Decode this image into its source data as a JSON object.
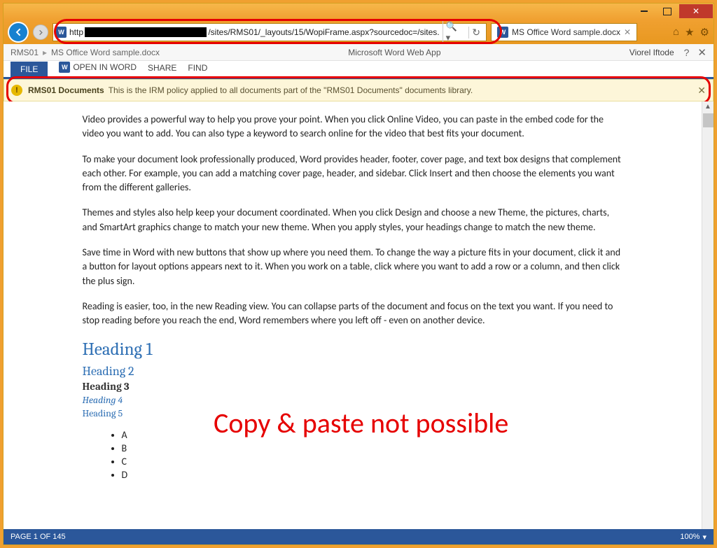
{
  "browser": {
    "url_prefix": "http",
    "url_suffix": "/sites/RMS01/_layouts/15/WopiFrame.aspx?sourcedoc=/sites.",
    "tab_title": "MS Office Word sample.docx"
  },
  "breadcrumb": {
    "site": "RMS01",
    "doc": "MS Office Word sample.docx",
    "app_name": "Microsoft Word Web App",
    "user": "Viorel Iftode"
  },
  "ribbon": {
    "file": "FILE",
    "open": "OPEN IN WORD",
    "share": "SHARE",
    "find": "FIND"
  },
  "notification": {
    "title": "RMS01 Documents",
    "text": "This is the IRM policy applied to all documents part of the \"RMS01 Documents\" documents library."
  },
  "document": {
    "p1": "Video provides a powerful way to help you prove your point. When you click Online Video, you can paste in the embed code for the video you want to add. You can also type a keyword to search online for the video that best fits your document.",
    "p2": "To make your document look professionally produced, Word provides header, footer, cover page, and text box designs that complement each other. For example, you can add a matching cover page, header, and sidebar. Click Insert and then choose the elements you want from the different galleries.",
    "p3": "Themes and styles also help keep your document coordinated. When you click Design and choose a new Theme, the pictures, charts, and SmartArt graphics change to match your new theme. When you apply styles, your headings change to match the new theme.",
    "p4": "Save time in Word with new buttons that show up where you need them. To change the way a picture fits in your document, click it and a button for layout options appears next to it. When you work on a table, click where you want to add a row or a column, and then click the plus sign.",
    "p5": "Reading is easier, too, in the new Reading view. You can collapse parts of the document and focus on the text you want. If you need to stop reading before you reach the end, Word remembers where you left off - even on another device.",
    "h1": "Heading 1",
    "h2": "Heading 2",
    "h3": "Heading 3",
    "h4": "Heading 4",
    "h5": "Heading 5",
    "bullets": [
      "A",
      "B",
      "C",
      "D"
    ]
  },
  "overlay": "Copy & paste not possible",
  "status": {
    "page": "PAGE 1 OF 145",
    "zoom": "100%"
  }
}
